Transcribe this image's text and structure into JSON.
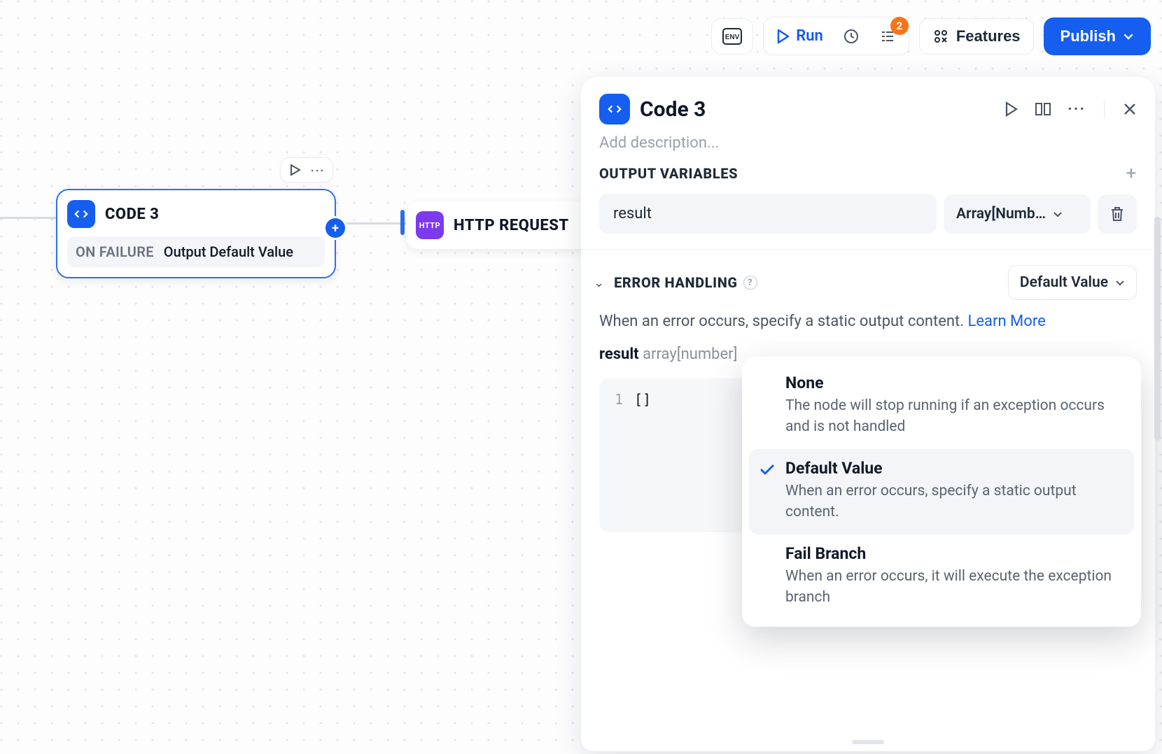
{
  "toolbar": {
    "run_label": "Run",
    "features_label": "Features",
    "publish_label": "Publish",
    "badge_count": "2",
    "env_label": "ENV"
  },
  "canvas": {
    "node1": {
      "title": "CODE 3",
      "failure_label": "ON FAILURE",
      "failure_value": "Output Default Value"
    },
    "node2": {
      "title": "HTTP REQUEST",
      "icon_text": "HTTP"
    }
  },
  "panel": {
    "title": "Code 3",
    "description_placeholder": "Add description...",
    "output_section": "OUTPUT VARIABLES",
    "output_var": "result",
    "output_type": "Array[Numb…",
    "error_section": "ERROR HANDLING",
    "error_select": "Default Value",
    "error_text_a": "When an error occurs, specify a static output content. ",
    "error_link": "Learn More",
    "result_key": "result",
    "result_type": "array[number]",
    "code_line_no": "1",
    "code_content": "[]"
  },
  "dropdown": {
    "opt_none_title": "None",
    "opt_none_desc": "The node will stop running if an exception occurs and is not handled",
    "opt_default_title": "Default Value",
    "opt_default_desc": "When an error occurs, specify a static output content.",
    "opt_fail_title": "Fail Branch",
    "opt_fail_desc": "When an error occurs, it will execute the exception branch"
  }
}
